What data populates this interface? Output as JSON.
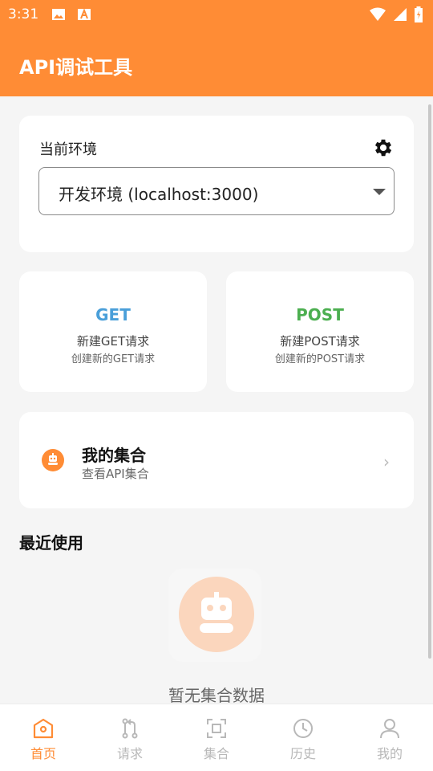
{
  "status_bar": {
    "time": "3:31"
  },
  "app_bar": {
    "title": "API调试工具"
  },
  "environment": {
    "label": "当前环境",
    "selected": "开发环境 (localhost:3000)"
  },
  "methods": [
    {
      "name": "GET",
      "title": "新建GET请求",
      "subtitle": "创建新的GET请求",
      "color": "#4a9fd9"
    },
    {
      "name": "POST",
      "title": "新建POST请求",
      "subtitle": "创建新的POST请求",
      "color": "#4caf50"
    }
  ],
  "collection": {
    "title": "我的集合",
    "subtitle": "查看API集合"
  },
  "recent": {
    "title": "最近使用",
    "empty_text": "暂无集合数据"
  },
  "bottom_nav": [
    {
      "label": "首页",
      "icon": "home-icon",
      "active": true
    },
    {
      "label": "请求",
      "icon": "request-icon",
      "active": false
    },
    {
      "label": "集合",
      "icon": "collection-icon",
      "active": false
    },
    {
      "label": "历史",
      "icon": "history-icon",
      "active": false
    },
    {
      "label": "我的",
      "icon": "profile-icon",
      "active": false
    }
  ],
  "colors": {
    "accent": "#ff8c35",
    "inactive": "#b8b8b8"
  }
}
